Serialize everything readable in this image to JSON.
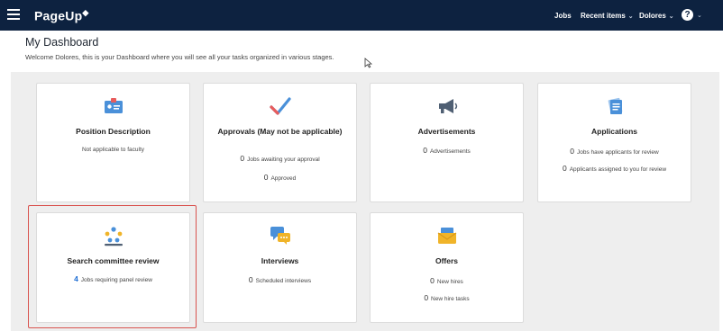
{
  "header": {
    "logo": "PageUp",
    "nav": [
      {
        "label": "Jobs",
        "chevron": ""
      },
      {
        "label": "Recent items",
        "chevron": "⌄"
      },
      {
        "label": "Dolores",
        "chevron": "⌄"
      }
    ],
    "help_label": "?",
    "help_chevron": "⌄"
  },
  "dashboard": {
    "title": "My Dashboard",
    "subtitle": "Welcome Dolores, this is your Dashboard where you will see all your tasks organized in various stages."
  },
  "cards": [
    {
      "title": "Position Description",
      "lines": [
        {
          "num": "",
          "text": "Not applicable to faculty"
        }
      ],
      "icon": "id-card-icon"
    },
    {
      "title": "Approvals (May not be applicable)",
      "lines": [
        {
          "num": "0",
          "text": "Jobs awaiting your approval"
        },
        {
          "num": "0",
          "text": "Approved"
        }
      ],
      "icon": "checkmark-icon"
    },
    {
      "title": "Advertisements",
      "lines": [
        {
          "num": "0",
          "text": "Advertisements"
        }
      ],
      "icon": "megaphone-icon"
    },
    {
      "title": "Applications",
      "lines": [
        {
          "num": "0",
          "text": "Jobs have applicants for review"
        },
        {
          "num": "0",
          "text": "Applicants assigned to you for review"
        }
      ],
      "icon": "document-stack-icon"
    },
    {
      "title": "Search committee review",
      "lines": [
        {
          "num": "4",
          "text": "Jobs requiring panel review"
        }
      ],
      "icon": "committee-people-icon"
    },
    {
      "title": "Interviews",
      "lines": [
        {
          "num": "0",
          "text": "Scheduled interviews"
        }
      ],
      "icon": "chat-bubbles-icon"
    },
    {
      "title": "Offers",
      "lines": [
        {
          "num": "0",
          "text": "New hires"
        },
        {
          "num": "0",
          "text": "New hire tasks"
        }
      ],
      "icon": "envelope-icon"
    }
  ],
  "colors": {
    "topbar": "#0d2240",
    "link_blue": "#1f6ed4",
    "highlight": "#d9534f"
  }
}
